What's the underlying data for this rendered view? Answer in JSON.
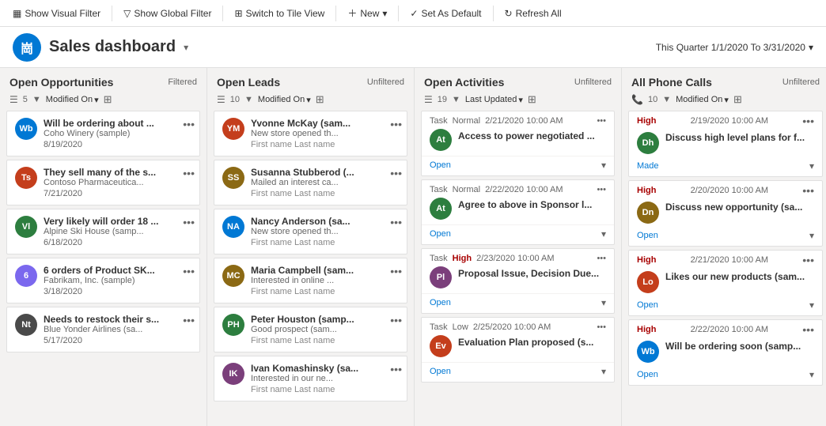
{
  "toolbar": {
    "show_visual_filter": "Show Visual Filter",
    "show_global_filter": "Show Global Filter",
    "switch_to_tile_view": "Switch to Tile View",
    "new_label": "New",
    "set_as_default": "Set As Default",
    "refresh_all": "Refresh All"
  },
  "header": {
    "title": "Sales dashboard",
    "logo_text": "崗",
    "date_range": "This Quarter 1/1/2020 To 3/31/2020"
  },
  "columns": [
    {
      "id": "open-opportunities",
      "title": "Open Opportunities",
      "filter_status": "Filtered",
      "sort_label": "Modified On",
      "count": "5",
      "cards": [
        {
          "avatar_text": "Wb",
          "avatar_color": "#0078d4",
          "name": "Will be ordering about ...",
          "sub": "Coho Winery (sample)",
          "date": "8/19/2020",
          "meta": ""
        },
        {
          "avatar_text": "Ts",
          "avatar_color": "#c43e1c",
          "name": "They sell many of the s...",
          "sub": "Contoso Pharmaceutica...",
          "date": "7/21/2020",
          "meta": ""
        },
        {
          "avatar_text": "Vl",
          "avatar_color": "#2d7e3f",
          "name": "Very likely will order 18 ...",
          "sub": "Alpine Ski House (samp...",
          "date": "6/18/2020",
          "meta": ""
        },
        {
          "avatar_text": "6",
          "avatar_color": "#7b68ee",
          "name": "6 orders of Product SK...",
          "sub": "Fabrikam, Inc. (sample)",
          "date": "3/18/2020",
          "meta": ""
        },
        {
          "avatar_text": "Nt",
          "avatar_color": "#4a4a4a",
          "name": "Needs to restock their s...",
          "sub": "Blue Yonder Airlines (sa...",
          "date": "5/17/2020",
          "meta": ""
        }
      ]
    },
    {
      "id": "open-leads",
      "title": "Open Leads",
      "filter_status": "Unfiltered",
      "sort_label": "Modified On",
      "count": "10",
      "cards": [
        {
          "avatar_text": "YM",
          "avatar_color": "#c43e1c",
          "name": "Yvonne McKay (sam...",
          "sub": "New store opened th...",
          "date": "",
          "meta": "First name Last name"
        },
        {
          "avatar_text": "SS",
          "avatar_color": "#8b6914",
          "name": "Susanna Stubberod (...",
          "sub": "Mailed an interest ca...",
          "date": "",
          "meta": "First name Last name"
        },
        {
          "avatar_text": "NA",
          "avatar_color": "#0078d4",
          "name": "Nancy Anderson (sa...",
          "sub": "New store opened th...",
          "date": "",
          "meta": "First name Last name"
        },
        {
          "avatar_text": "MC",
          "avatar_color": "#8b6914",
          "name": "Maria Campbell (sam...",
          "sub": "Interested in online ...",
          "date": "",
          "meta": "First name Last name"
        },
        {
          "avatar_text": "PH",
          "avatar_color": "#2d7e3f",
          "name": "Peter Houston (samp...",
          "sub": "Good prospect (sam...",
          "date": "",
          "meta": "First name Last name"
        },
        {
          "avatar_text": "IK",
          "avatar_color": "#7b3f7b",
          "name": "Ivan Komashinsky (sa...",
          "sub": "Interested in our ne...",
          "date": "",
          "meta": "First name Last name"
        }
      ]
    },
    {
      "id": "open-activities",
      "title": "Open Activities",
      "filter_status": "Unfiltered",
      "sort_label": "Last Updated",
      "count": "19",
      "activities": [
        {
          "type": "Task",
          "priority": "Normal",
          "datetime": "2/21/2020 10:00 AM",
          "avatar_text": "At",
          "avatar_color": "#2d7e3f",
          "subject": "Access to power negotiated ...",
          "status": "Open"
        },
        {
          "type": "Task",
          "priority": "Normal",
          "datetime": "2/22/2020 10:00 AM",
          "avatar_text": "At",
          "avatar_color": "#2d7e3f",
          "subject": "Agree to above in Sponsor l...",
          "status": "Open"
        },
        {
          "type": "Task",
          "priority": "High",
          "datetime": "2/23/2020 10:00 AM",
          "avatar_text": "Pl",
          "avatar_color": "#7b3f7b",
          "subject": "Proposal Issue, Decision Due...",
          "status": "Open"
        },
        {
          "type": "Task",
          "priority": "Low",
          "datetime": "2/25/2020 10:00 AM",
          "avatar_text": "Ev",
          "avatar_color": "#c43e1c",
          "subject": "Evaluation Plan proposed (s...",
          "status": "Open"
        }
      ]
    },
    {
      "id": "all-phone-calls",
      "title": "All Phone Calls",
      "filter_status": "Unfiltered",
      "sort_label": "Modified On",
      "count": "10",
      "calls": [
        {
          "priority": "High",
          "datetime": "2/19/2020 10:00 AM",
          "avatar_text": "Dh",
          "avatar_color": "#2d7e3f",
          "subject": "Discuss high level plans for f...",
          "status": "Made"
        },
        {
          "priority": "High",
          "datetime": "2/20/2020 10:00 AM",
          "avatar_text": "Dn",
          "avatar_color": "#8b6914",
          "subject": "Discuss new opportunity (sa...",
          "status": "Open"
        },
        {
          "priority": "High",
          "datetime": "2/21/2020 10:00 AM",
          "avatar_text": "Lo",
          "avatar_color": "#c43e1c",
          "subject": "Likes our new products (sam...",
          "status": "Open"
        },
        {
          "priority": "High",
          "datetime": "2/22/2020 10:00 AM",
          "avatar_text": "Wb",
          "avatar_color": "#0078d4",
          "subject": "Will be ordering soon (samp...",
          "status": "Open"
        }
      ]
    }
  ]
}
